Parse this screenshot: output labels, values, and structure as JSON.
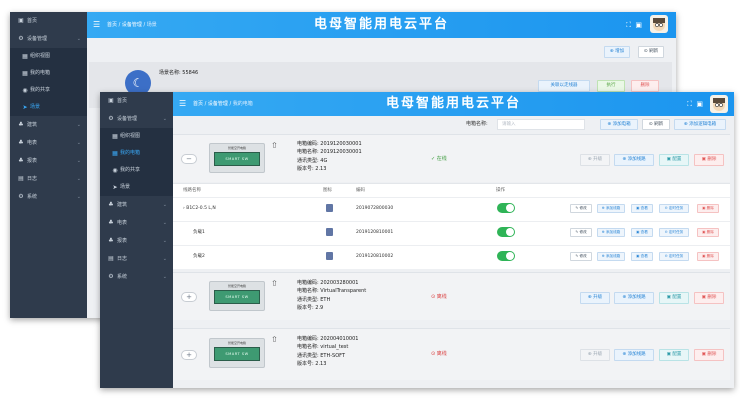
{
  "app": {
    "title": "电母智能用电云平台"
  },
  "back_window": {
    "sidebar": [
      {
        "icon": "home-icon",
        "label": "首页",
        "glyph": "▣",
        "active": false,
        "sub": false
      },
      {
        "icon": "settings-icon",
        "label": "设备管理",
        "glyph": "⚙",
        "active": false,
        "sub": false,
        "caret": "⌄"
      },
      {
        "icon": "grid-icon",
        "label": "组织视图",
        "glyph": "▦",
        "active": false,
        "sub": true
      },
      {
        "icon": "grid-icon",
        "label": "我的电箱",
        "glyph": "▦",
        "active": false,
        "sub": true
      },
      {
        "icon": "user-icon",
        "label": "我的共享",
        "glyph": "◉",
        "active": false,
        "sub": true
      },
      {
        "icon": "send-icon",
        "label": "场景",
        "glyph": "➤",
        "active": true,
        "sub": true
      },
      {
        "icon": "tree-icon",
        "label": "建筑",
        "glyph": "♣",
        "active": false,
        "sub": false,
        "caret": "⌄"
      },
      {
        "icon": "tree-icon",
        "label": "电表",
        "glyph": "♣",
        "active": false,
        "sub": false,
        "caret": "⌄"
      },
      {
        "icon": "tree-icon",
        "label": "报表",
        "glyph": "♣",
        "active": false,
        "sub": false,
        "caret": "⌄"
      },
      {
        "icon": "calendar-icon",
        "label": "日志",
        "glyph": "▤",
        "active": false,
        "sub": false,
        "caret": "⌄"
      },
      {
        "icon": "system-icon",
        "label": "系统",
        "glyph": "⚙",
        "active": false,
        "sub": false,
        "caret": "⌄"
      }
    ],
    "breadcrumb": [
      "首页",
      "设备管理",
      "场景"
    ],
    "add_label": "⊕ 增加",
    "refresh_label": "⊙ 刷新",
    "scene_name_label": "场景名称: 55846",
    "link_label": "关联以走线器",
    "run_label": "执行",
    "delete_label": "删除"
  },
  "front_window": {
    "sidebar": [
      {
        "icon": "home-icon",
        "label": "首页",
        "glyph": "▣",
        "active": false,
        "sub": false
      },
      {
        "icon": "settings-icon",
        "label": "设备管理",
        "glyph": "⚙",
        "active": false,
        "sub": false,
        "caret": "⌄"
      },
      {
        "icon": "grid-icon",
        "label": "组织视图",
        "glyph": "▦",
        "active": false,
        "sub": true
      },
      {
        "icon": "grid-icon",
        "label": "我的电箱",
        "glyph": "▦",
        "active": true,
        "sub": true
      },
      {
        "icon": "user-icon",
        "label": "我的共享",
        "glyph": "◉",
        "active": false,
        "sub": true
      },
      {
        "icon": "send-icon",
        "label": "场景",
        "glyph": "➤",
        "active": false,
        "sub": true
      },
      {
        "icon": "tree-icon",
        "label": "建筑",
        "glyph": "♣",
        "active": false,
        "sub": false,
        "caret": "⌄"
      },
      {
        "icon": "tree-icon",
        "label": "电表",
        "glyph": "♣",
        "active": false,
        "sub": false,
        "caret": "⌄"
      },
      {
        "icon": "tree-icon",
        "label": "报表",
        "glyph": "♣",
        "active": false,
        "sub": false,
        "caret": "⌄"
      },
      {
        "icon": "calendar-icon",
        "label": "日志",
        "glyph": "▤",
        "active": false,
        "sub": false,
        "caret": "⌄"
      },
      {
        "icon": "system-icon",
        "label": "系统",
        "glyph": "⚙",
        "active": false,
        "sub": false,
        "caret": "⌄"
      }
    ],
    "breadcrumb": [
      "首页",
      "设备管理",
      "我的电箱"
    ],
    "toolbar": {
      "name_label": "电箱名称:",
      "name_placeholder": "请输入",
      "add_box": "⊕ 添加电箱",
      "refresh": "⊙ 刷新",
      "add_logic_box": "⊕ 添加逻辑电箱"
    },
    "boxes": [
      {
        "expand": "−",
        "meter_label": "智能空开电箱",
        "meter_screen": "SMART SW",
        "code": "电箱编码: 2019120030001",
        "name": "电箱名称: 2019120030001",
        "comm": "通讯类型: 4G",
        "version": "版本号: 2.13",
        "status": "✓ 在线",
        "online": true
      },
      {
        "expand": "+",
        "meter_label": "智能空开电箱",
        "meter_screen": "SMART SW",
        "code": "电箱编码: 202003280001",
        "name": "电箱名称: VirtualTransparent",
        "comm": "通讯类型: ETH",
        "version": "版本号: 2.9",
        "status": "⊙ 离线",
        "online": false
      },
      {
        "expand": "+",
        "meter_label": "智能空开电箱",
        "meter_screen": "SMART SW",
        "code": "电箱编码: 202004010001",
        "name": "电箱名称: virtual_test",
        "comm": "通讯类型: ETH-SOFT",
        "version": "版本号: 2.13",
        "status": "⊙ 离线",
        "online": false
      }
    ],
    "box_buttons": {
      "upgrade": "⊕ 升级",
      "add_line": "⊕ 添加线路",
      "config": "▣ 配置",
      "delete": "▣ 删除"
    },
    "table": {
      "headers": [
        "线路名称",
        "图标",
        "编码",
        "操作"
      ],
      "rows": [
        {
          "name": "› B1C2-0.5 L,N",
          "code": "2019072800030",
          "icon": "plug-icon",
          "on": true
        },
        {
          "name": "负载1",
          "code": "2019120810001",
          "icon": "device-icon",
          "on": true
        },
        {
          "name": "负载2",
          "code": "2019120810002",
          "icon": "device-icon",
          "on": true
        }
      ],
      "row_buttons": {
        "edit": "✎ 修改",
        "add_line": "⊕ 添加线路",
        "view": "▣ 查看",
        "timer": "⊙ 定时任务",
        "delete": "▣ 删除"
      }
    }
  }
}
